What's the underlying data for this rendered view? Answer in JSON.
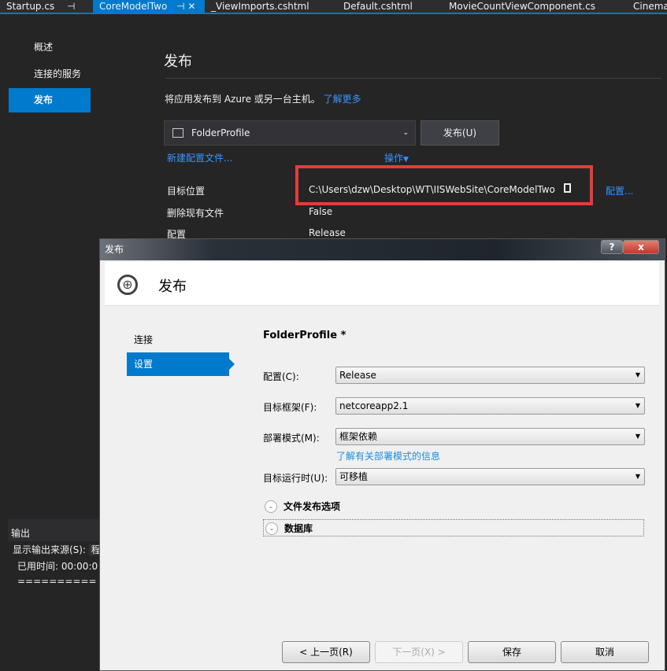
{
  "tabs": [
    {
      "label": "Startup.cs",
      "pin": "⊣"
    },
    {
      "label": "CoreModelTwo",
      "pin": "⊣",
      "close": "✕",
      "active": true
    },
    {
      "label": "_ViewImports.cshtml"
    },
    {
      "label": "Default.cshtml"
    },
    {
      "label": "MovieCountViewComponent.cs"
    },
    {
      "label": "Cinema"
    }
  ],
  "sidebar": {
    "items": [
      {
        "label": "概述"
      },
      {
        "label": "连接的服务"
      },
      {
        "label": "发布",
        "selected": true
      }
    ]
  },
  "main": {
    "title": "发布",
    "description": "将应用发布到 Azure 或另一台主机。",
    "learn_more": "了解更多",
    "profile": "FolderProfile",
    "publish_button": "发布(U)",
    "new_profile": "新建配置文件...",
    "actions": "操作",
    "props": [
      {
        "label": "目标位置",
        "value": "C:\\Users\\dzw\\Desktop\\WT\\IISWebSite\\CoreModelTwo"
      },
      {
        "label": "删除现有文件",
        "value": "False"
      },
      {
        "label": "配置",
        "value": "Release"
      }
    ],
    "configure": "配置..."
  },
  "output": {
    "title": "输出",
    "source_label": "显示输出来源(S):",
    "source_value": "程",
    "line1": "已用时间: 00:00:0",
    "line2": "========== 已完成"
  },
  "dialog": {
    "title": "发布",
    "help": "?",
    "close": "x",
    "header": "发布",
    "nav": [
      {
        "label": "连接"
      },
      {
        "label": "设置",
        "selected": true
      }
    ],
    "profile_name": "FolderProfile *",
    "fields": [
      {
        "label": "配置(C):",
        "value": "Release"
      },
      {
        "label": "目标框架(F):",
        "value": "netcoreapp2.1"
      },
      {
        "label": "部署模式(M):",
        "value": "框架依赖"
      },
      {
        "label": "目标运行时(U):",
        "value": "可移植"
      }
    ],
    "deploy_link": "了解有关部署模式的信息",
    "sections": [
      "文件发布选项",
      "数据库"
    ],
    "buttons": {
      "prev": "< 上一页(R)",
      "next": "下一页(X) >",
      "save": "保存",
      "cancel": "取消"
    }
  },
  "colors": {
    "accent": "#007acc",
    "highlight": "#e83a3a"
  }
}
